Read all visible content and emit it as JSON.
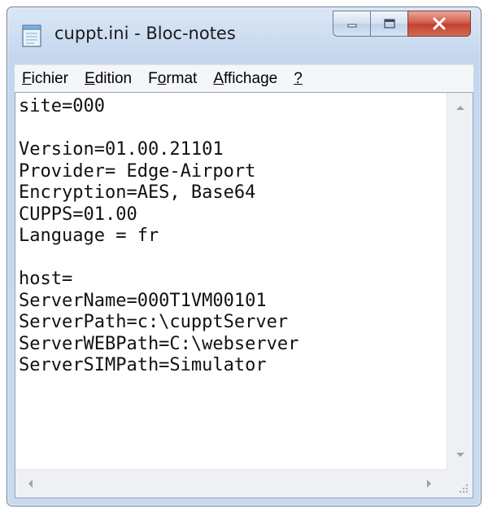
{
  "window": {
    "title": "cuppt.ini - Bloc-notes",
    "caption_buttons": {
      "minimize_icon": "minimize-icon",
      "maximize_icon": "maximize-icon",
      "close_icon": "close-icon"
    }
  },
  "menu": {
    "items": [
      {
        "label": "Fichier",
        "mnemonic_index": 0
      },
      {
        "label": "Edition",
        "mnemonic_index": 0
      },
      {
        "label": "Format",
        "mnemonic_index": 1
      },
      {
        "label": "Affichage",
        "mnemonic_index": 0
      },
      {
        "label": "?",
        "mnemonic_index": 0
      }
    ]
  },
  "editor": {
    "lines": [
      "site=000",
      "",
      "Version=01.00.21101",
      "Provider= Edge-Airport",
      "Encryption=AES, Base64",
      "CUPPS=01.00",
      "Language = fr",
      "",
      "host=",
      "ServerName=000T1VM00101",
      "ServerPath=c:\\cupptServer",
      "ServerWEBPath=C:\\webserver",
      "ServerSIMPath=Simulator"
    ]
  },
  "colors": {
    "close_button": "#c3402f",
    "title_bar": "#c5d7ee"
  }
}
